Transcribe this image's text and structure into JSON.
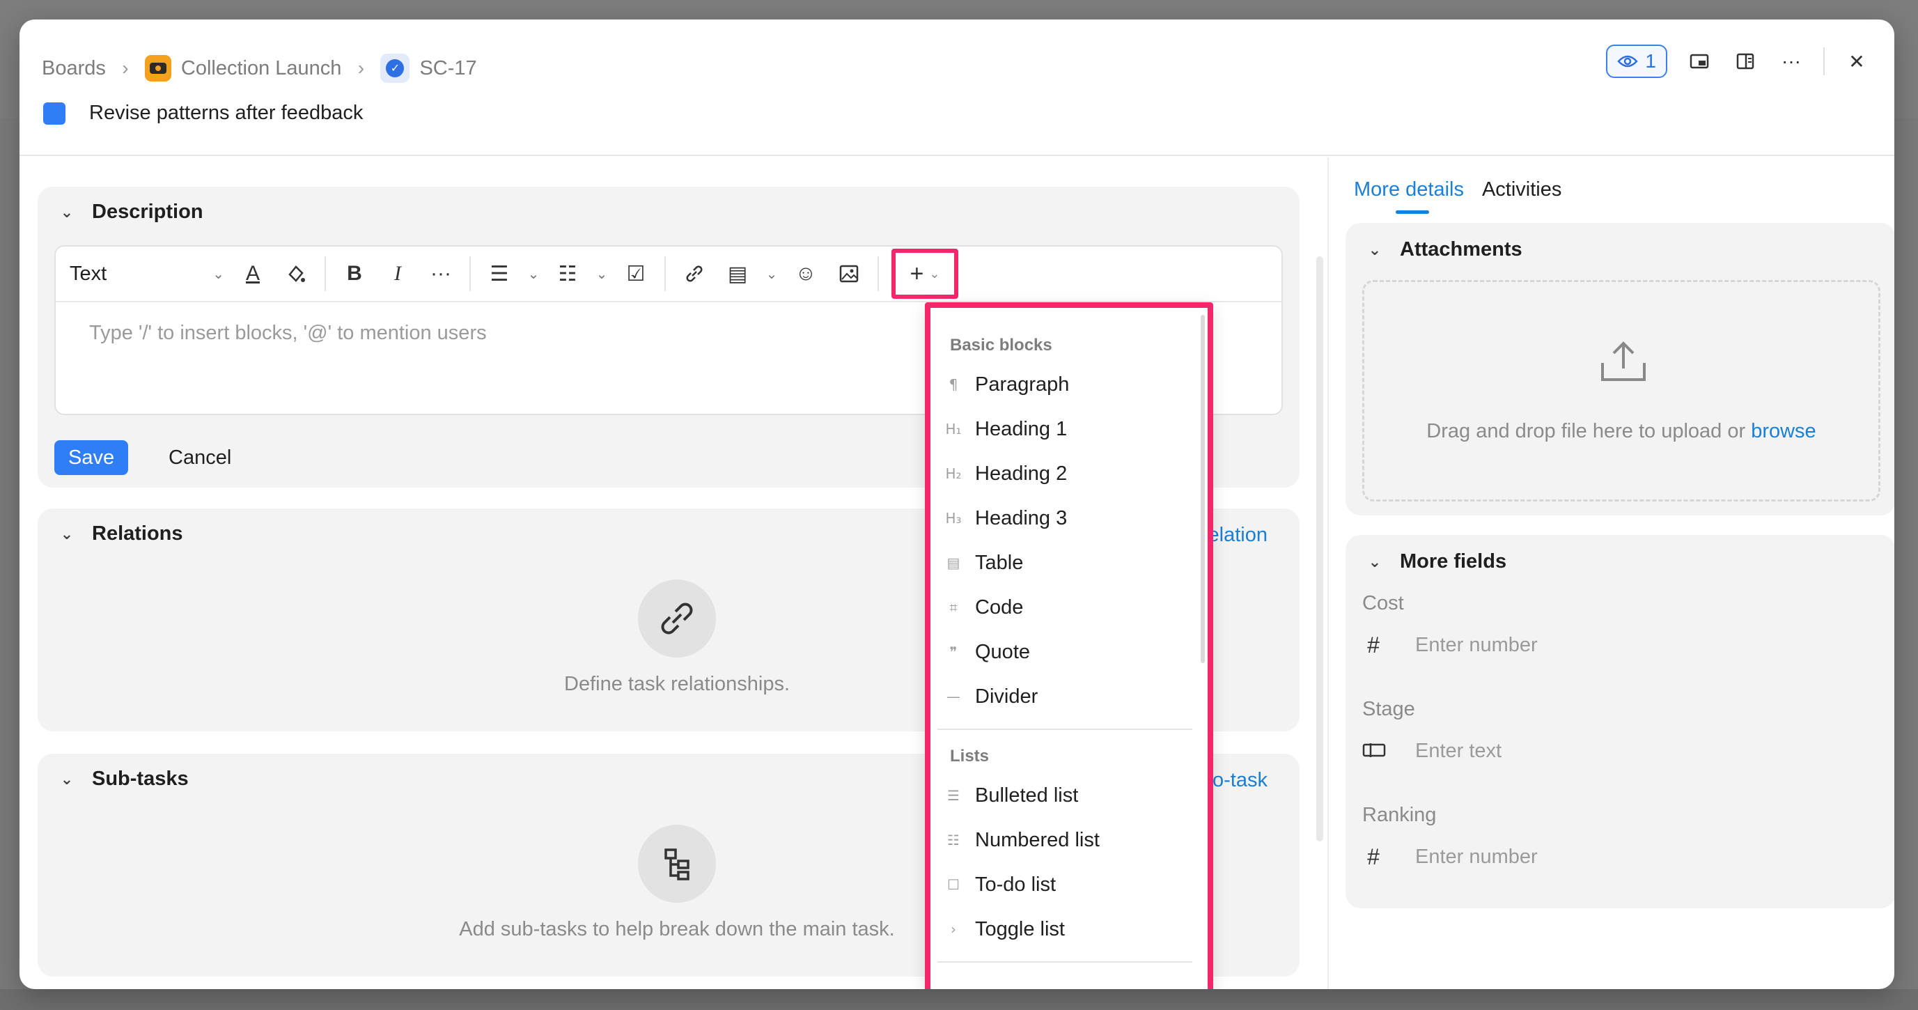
{
  "breadcrumb": {
    "boards": "Boards",
    "project": "Collection Launch",
    "task_id": "SC-17"
  },
  "task": {
    "title": "Revise patterns after feedback",
    "color": "#2f7ef5"
  },
  "header_actions": {
    "watchers_count": "1"
  },
  "description": {
    "heading": "Description",
    "text_style": "Text",
    "placeholder": "Type '/' to insert blocks, '@' to mention users",
    "save_label": "Save",
    "cancel_label": "Cancel"
  },
  "relations": {
    "heading": "Relations",
    "link_label": "elation",
    "empty_text": "Define task relationships."
  },
  "subtasks": {
    "heading": "Sub-tasks",
    "link_label": "o-task",
    "empty_text": "Add sub-tasks to help break down the main task."
  },
  "right_panel": {
    "tabs": [
      "More details",
      "Activities"
    ],
    "attachments": {
      "heading": "Attachments",
      "drop_text": "Drag and drop file here to upload or",
      "browse_label": "browse"
    },
    "more_fields": {
      "heading": "More fields",
      "fields": [
        {
          "label": "Cost",
          "icon": "hash-icon",
          "placeholder": "Enter number"
        },
        {
          "label": "Stage",
          "icon": "text-field-icon",
          "placeholder": "Enter text"
        },
        {
          "label": "Ranking",
          "icon": "hash-icon",
          "placeholder": "Enter number"
        }
      ]
    }
  },
  "insert_menu": {
    "groups": [
      {
        "label": "Basic blocks",
        "items": [
          {
            "label": "Paragraph",
            "icon": "¶"
          },
          {
            "label": "Heading 1",
            "icon": "H₁"
          },
          {
            "label": "Heading 2",
            "icon": "H₂"
          },
          {
            "label": "Heading 3",
            "icon": "H₃"
          },
          {
            "label": "Table",
            "icon": "▤"
          },
          {
            "label": "Code",
            "icon": "⌗"
          },
          {
            "label": "Quote",
            "icon": "❞"
          },
          {
            "label": "Divider",
            "icon": "—"
          }
        ]
      },
      {
        "label": "Lists",
        "items": [
          {
            "label": "Bulleted list",
            "icon": "☰"
          },
          {
            "label": "Numbered list",
            "icon": "☷"
          },
          {
            "label": "To-do list",
            "icon": "☐"
          },
          {
            "label": "Toggle list",
            "icon": "›"
          }
        ]
      }
    ]
  },
  "colors": {
    "accent": "#1a7fd6",
    "primary_button": "#2f7ef5",
    "highlight": "#f5276b"
  }
}
